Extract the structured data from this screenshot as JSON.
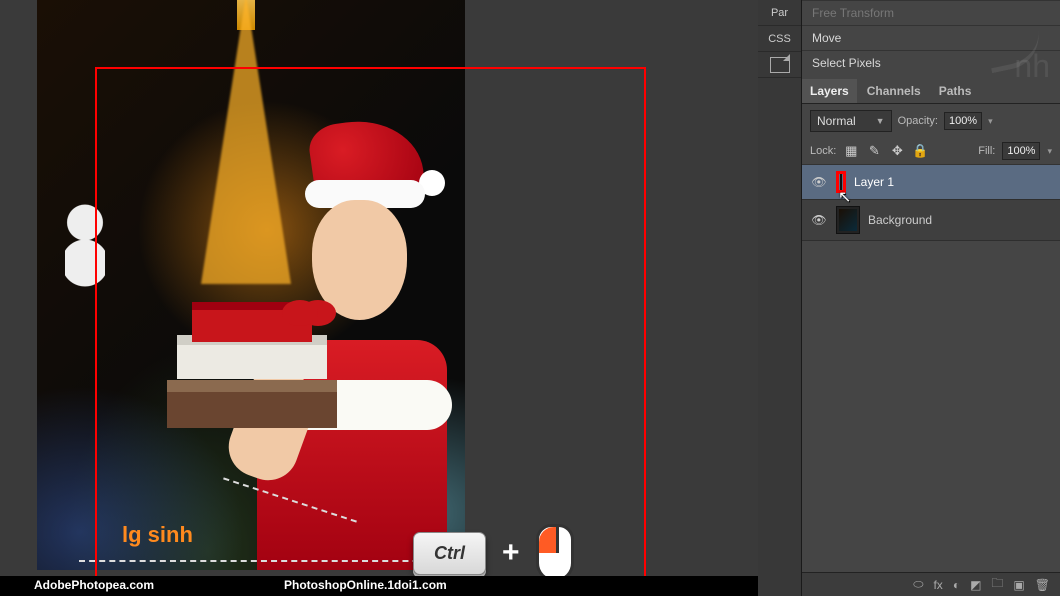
{
  "context_menu": {
    "free_transform": "Free Transform",
    "move": "Move",
    "select_pixels": "Select Pixels"
  },
  "side_tabs": {
    "par": "Par",
    "css": "CSS"
  },
  "panel_tabs": {
    "layers": "Layers",
    "channels": "Channels",
    "paths": "Paths"
  },
  "blend": {
    "mode": "Normal",
    "opacity_label": "Opacity:",
    "opacity_value": "100%",
    "lock_label": "Lock:",
    "fill_label": "Fill:",
    "fill_value": "100%"
  },
  "layers": [
    {
      "name": "Layer 1",
      "visible": true,
      "selected": true
    },
    {
      "name": "Background",
      "visible": true,
      "selected": false
    }
  ],
  "key_hint": {
    "key": "Ctrl",
    "plus": "+"
  },
  "canvas_logo": "lg sinh",
  "footer": {
    "left": "AdobePhotopea.com",
    "right": "PhotoshopOnline.1doi1.com"
  },
  "watermark": "nh"
}
